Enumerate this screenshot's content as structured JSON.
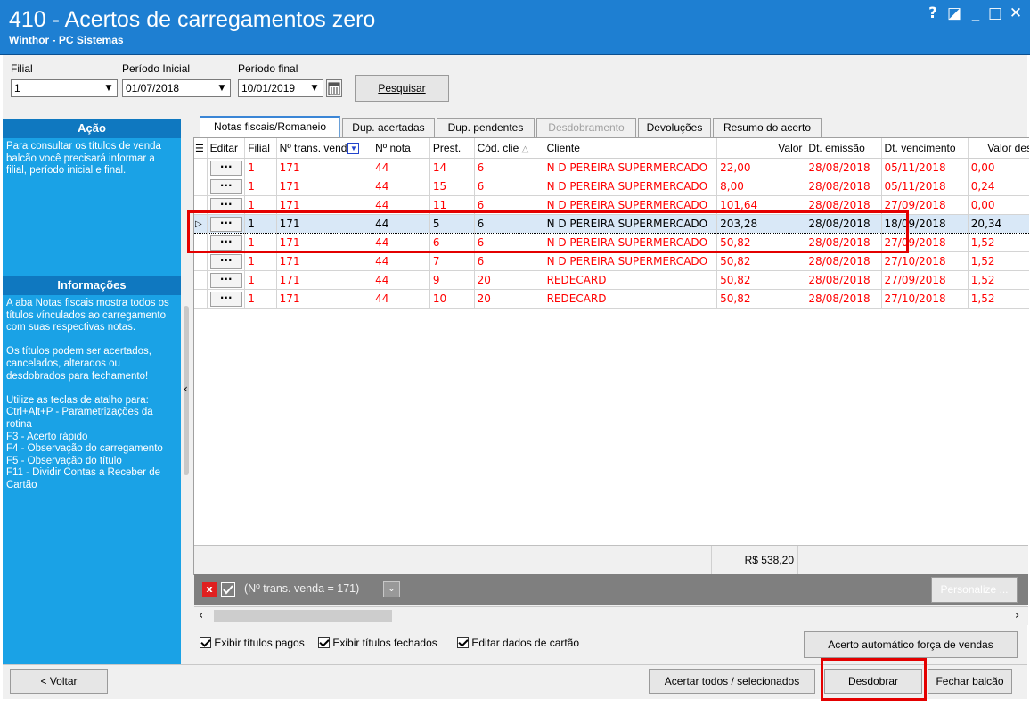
{
  "window": {
    "title": "410 - Acertos de carregamentos zero",
    "subtitle": "Winthor - PC Sistemas",
    "controls": {
      "help": "?",
      "restore": "◪",
      "minimize": "_",
      "maximize": "□",
      "close": "✕"
    }
  },
  "filters": {
    "filial_label": "Filial",
    "filial_value": "1",
    "periodo_inicial_label": "Período Inicial",
    "periodo_inicial_value": "01/07/2018",
    "periodo_final_label": "Período final",
    "periodo_final_value": "10/01/2019",
    "pesquisar_label": "Pesquisar"
  },
  "sidebar": {
    "acao_title": "Ação",
    "acao_text": "Para consultar os títulos de venda balcão você precisará informar a filial, período inicial e final.",
    "info_title": "Informações",
    "info_text": "A aba Notas fiscais mostra todos os títulos vínculados ao carregamento com suas respectivas notas.\n\nOs títulos podem ser acertados, cancelados, alterados ou desdobrados para fechamento!\n\nUtilize as teclas de atalho para:\nCtrl+Alt+P - Parametrizações da rotina\nF3 - Acerto rápido\nF4 - Observação do carregamento\nF5 - Observação do título\nF11 - Dividir Contas a Receber de Cartão"
  },
  "tabs": [
    {
      "label": "Notas fiscais/Romaneio",
      "active": true
    },
    {
      "label": "Dup. acertadas"
    },
    {
      "label": "Dup. pendentes"
    },
    {
      "label": "Desdobramento",
      "disabled": true
    },
    {
      "label": "Devoluções"
    },
    {
      "label": "Resumo do acerto"
    }
  ],
  "grid": {
    "columns": [
      "Editar",
      "Filial",
      "Nº trans. vend",
      "Nº nota",
      "Prest.",
      "Cód. clie",
      "Cliente",
      "Valor",
      "Dt. emissão",
      "Dt. vencimento",
      "Valor desc"
    ],
    "rows": [
      {
        "filial": "1",
        "trans": "171",
        "nota": "44",
        "prest": "14",
        "cod": "6",
        "cliente": "N D PEREIRA SUPERMERCADO",
        "valor": "22,00",
        "emissao": "28/08/2018",
        "vencimento": "05/11/2018",
        "desc": "0,00",
        "state": "red"
      },
      {
        "filial": "1",
        "trans": "171",
        "nota": "44",
        "prest": "15",
        "cod": "6",
        "cliente": "N D PEREIRA SUPERMERCADO",
        "valor": "8,00",
        "emissao": "28/08/2018",
        "vencimento": "05/11/2018",
        "desc": "0,24",
        "state": "red"
      },
      {
        "filial": "1",
        "trans": "171",
        "nota": "44",
        "prest": "11",
        "cod": "6",
        "cliente": "N D PEREIRA SUPERMERCADO",
        "valor": "101,64",
        "emissao": "28/08/2018",
        "vencimento": "27/09/2018",
        "desc": "0,00",
        "state": "red"
      },
      {
        "filial": "1",
        "trans": "171",
        "nota": "44",
        "prest": "5",
        "cod": "6",
        "cliente": "N D PEREIRA SUPERMERCADO",
        "valor": "203,28",
        "emissao": "28/08/2018",
        "vencimento": "18/09/2018",
        "desc": "20,34",
        "state": "selected"
      },
      {
        "filial": "1",
        "trans": "171",
        "nota": "44",
        "prest": "6",
        "cod": "6",
        "cliente": "N D PEREIRA SUPERMERCADO",
        "valor": "50,82",
        "emissao": "28/08/2018",
        "vencimento": "27/09/2018",
        "desc": "1,52",
        "state": "red"
      },
      {
        "filial": "1",
        "trans": "171",
        "nota": "44",
        "prest": "7",
        "cod": "6",
        "cliente": "N D PEREIRA SUPERMERCADO",
        "valor": "50,82",
        "emissao": "28/08/2018",
        "vencimento": "27/10/2018",
        "desc": "1,52",
        "state": "red"
      },
      {
        "filial": "1",
        "trans": "171",
        "nota": "44",
        "prest": "9",
        "cod": "20",
        "cliente": "REDECARD",
        "valor": "50,82",
        "emissao": "28/08/2018",
        "vencimento": "27/09/2018",
        "desc": "1,52",
        "state": "red"
      },
      {
        "filial": "1",
        "trans": "171",
        "nota": "44",
        "prest": "10",
        "cod": "20",
        "cliente": "REDECARD",
        "valor": "50,82",
        "emissao": "28/08/2018",
        "vencimento": "27/10/2018",
        "desc": "1,52",
        "state": "red"
      }
    ],
    "edit_button_label": "···",
    "total": "R$ 538,20"
  },
  "filterbar": {
    "text": "(Nº trans. venda = 171)",
    "personalize_label": "Personalize ..."
  },
  "options": {
    "exibir_pagos": "Exibir títulos pagos",
    "exibir_fechados": "Exibir títulos fechados",
    "editar_cartao": "Editar dados de cartão",
    "acerto_automatico": "Acerto automático força de vendas"
  },
  "bottom": {
    "voltar": "< Voltar",
    "acertar_todos": "Acertar todos / selecionados",
    "desdobrar": "Desdobrar",
    "fechar_balcao": "Fechar balcão"
  },
  "colors": {
    "titlebar": "#1e7fd2",
    "sidebar": "#1aa2e6",
    "row_text": "#ff0000",
    "highlight": "#e40000"
  }
}
